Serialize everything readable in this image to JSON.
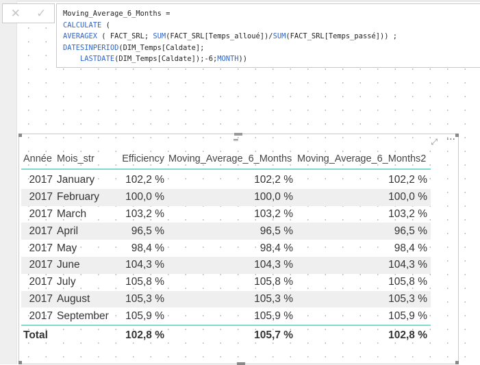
{
  "formula_bar": {
    "cancel_icon": "close-icon",
    "commit_icon": "check-icon",
    "lines": [
      [
        {
          "t": "Moving_Average_6_Months =",
          "k": false
        }
      ],
      [
        {
          "t": "CALCULATE",
          "k": true
        },
        {
          "t": " (",
          "k": false
        }
      ],
      [
        {
          "t": "AVERAGEX",
          "k": true
        },
        {
          "t": " ( FACT_SRL; ",
          "k": false
        },
        {
          "t": "SUM",
          "k": true
        },
        {
          "t": "(FACT_SRL[Temps_alloué])/",
          "k": false
        },
        {
          "t": "SUM",
          "k": true
        },
        {
          "t": "(FACT_SRL[Temps_passé])) ;",
          "k": false
        }
      ],
      [
        {
          "t": "DATESINPERIOD",
          "k": true
        },
        {
          "t": "(DIM_Temps[Caldate];",
          "k": false
        }
      ],
      [
        {
          "t": "    ",
          "k": false
        },
        {
          "t": "LASTDATE",
          "k": true
        },
        {
          "t": "(DIM_Temps[Caldate]);-6;",
          "k": false
        },
        {
          "t": "MONTH",
          "k": true
        },
        {
          "t": "))",
          "k": false
        }
      ]
    ]
  },
  "table": {
    "headers": [
      "Année",
      "Mois_str",
      "Efficiency",
      "Moving_Average_6_Months",
      "Moving_Average_6_Months2"
    ],
    "rows": [
      [
        "2017",
        "January",
        "102,2 %",
        "102,2 %",
        "102,2 %"
      ],
      [
        "2017",
        "February",
        "100,0 %",
        "100,0 %",
        "100,0 %"
      ],
      [
        "2017",
        "March",
        "103,2 %",
        "103,2 %",
        "103,2 %"
      ],
      [
        "2017",
        "April",
        "96,5 %",
        "96,5 %",
        "96,5 %"
      ],
      [
        "2017",
        "May",
        "98,4 %",
        "98,4 %",
        "98,4 %"
      ],
      [
        "2017",
        "June",
        "104,3 %",
        "104,3 %",
        "104,3 %"
      ],
      [
        "2017",
        "July",
        "105,8 %",
        "105,8 %",
        "105,8 %"
      ],
      [
        "2017",
        "August",
        "105,3 %",
        "105,3 %",
        "105,3 %"
      ],
      [
        "2017",
        "September",
        "105,9 %",
        "105,9 %",
        "105,9 %"
      ]
    ],
    "total": [
      "Total",
      "",
      "102,8 %",
      "105,7 %",
      "102,8 %"
    ]
  },
  "colors": {
    "keyword": "#3165c4",
    "accent_line": "#7fd9d1",
    "alt_row": "#efefef"
  }
}
